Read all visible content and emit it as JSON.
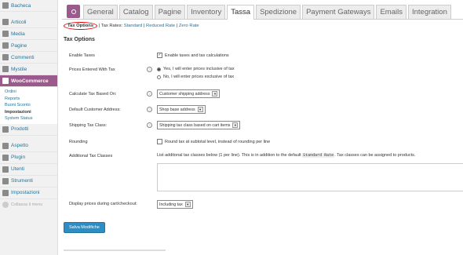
{
  "sidebar": {
    "items": [
      {
        "label": "Bacheca",
        "icon": "dashboard-icon"
      },
      {
        "label": "Articoli",
        "icon": "pin-icon"
      },
      {
        "label": "Media",
        "icon": "media-icon"
      },
      {
        "label": "Pagine",
        "icon": "page-icon"
      },
      {
        "label": "Commenti",
        "icon": "comment-icon"
      },
      {
        "label": "Mystile",
        "icon": "theme-icon"
      },
      {
        "label": "WooCommerce",
        "icon": "woocommerce-icon"
      }
    ],
    "woo_submenu": [
      "Ordini",
      "Reports",
      "Buoni Sconto",
      "Impostazioni",
      "System Status"
    ],
    "items2": [
      {
        "label": "Prodotti",
        "icon": "product-icon"
      },
      {
        "label": "Aspetto",
        "icon": "appearance-icon"
      },
      {
        "label": "Plugin",
        "icon": "plugin-icon"
      },
      {
        "label": "Utenti",
        "icon": "users-icon"
      },
      {
        "label": "Strumenti",
        "icon": "tools-icon"
      },
      {
        "label": "Impostazioni",
        "icon": "settings-icon"
      }
    ],
    "collapse": "Collassa il menu"
  },
  "tabs": [
    "General",
    "Catalog",
    "Pagine",
    "Inventory",
    "Tassa",
    "Spedizione",
    "Payment Gateways",
    "Emails",
    "Integration"
  ],
  "subsub": {
    "current": "Tax Options",
    "prefix": "| Tax Rates:",
    "links": [
      "Standard",
      "Reduced Rate",
      "Zero Rate"
    ],
    "sep": "|"
  },
  "section_title": "Tax Options",
  "fields": {
    "enable_taxes": {
      "label": "Enable Taxes",
      "text": "Enable taxes and tax calculations"
    },
    "prices_entered": {
      "label": "Prices Entered With Tax",
      "opt1": "Yes, I will enter prices inclusive of tax",
      "opt2": "No, I will enter prices exclusive of tax"
    },
    "calc_based": {
      "label": "Calculate Tax Based On:",
      "value": "Customer shipping address"
    },
    "default_addr": {
      "label": "Default Customer Address:",
      "value": "Shop base address"
    },
    "shipping_class": {
      "label": "Shipping Tax Class:",
      "value": "Shipping tax class based on cart items"
    },
    "rounding": {
      "label": "Rounding",
      "text": "Round tax at subtotal level, instead of rounding per line"
    },
    "additional": {
      "label": "Additional Tax Classes",
      "desc1": "List additonal tax classes below (1 per line). This is in addition to the default",
      "code": "Standard Rate",
      "desc2": ". Tax classes can be assigned to products."
    },
    "display_prices": {
      "label": "Display prices during cart/checkout:",
      "value": "Including tax"
    }
  },
  "save_label": "Salva Modifiche"
}
